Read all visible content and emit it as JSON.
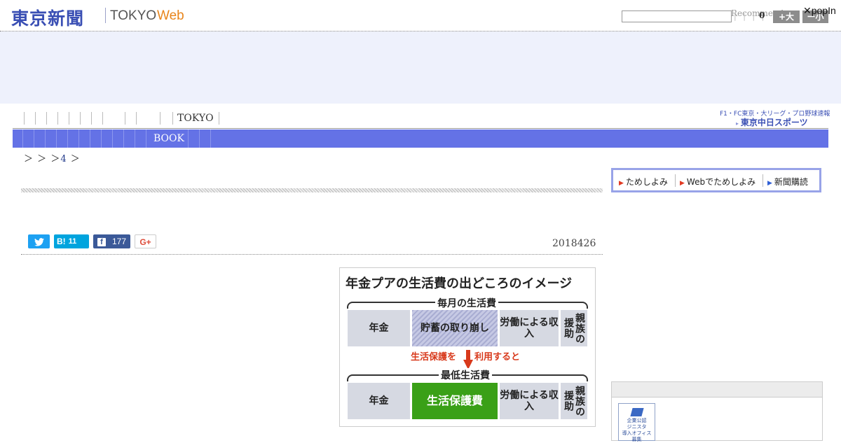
{
  "header": {
    "logo_jp": "東京新聞",
    "logo_tokyo": "TOKYO",
    "logo_web": "Web",
    "search_placeholder": "",
    "recommend_label": "Recommend",
    "share_count": "0",
    "font_large_label": "+大",
    "font_small_label": "ー小",
    "popin_label": "popIn",
    "ticks": "| | | |"
  },
  "nav": {
    "top_label": "TOKYO",
    "blue_label": "BOOK"
  },
  "sports": {
    "top_text": "F1・FC東京・大リーグ・プロ野球速報",
    "logo_text": "東京中日スポーツ"
  },
  "breadcrumb": {
    "part1": "＞",
    "part2": "＞",
    "part3": "＞",
    "link": "4",
    "part4": "＞"
  },
  "subscribe": {
    "item1": "ためしよみ",
    "item2": "Webでためしよみ",
    "item3": "新聞購読"
  },
  "social": {
    "hatena_label": "B!",
    "hatena_count": "11",
    "facebook_count": "177",
    "gplus_label": "G+"
  },
  "article": {
    "date": "2018426"
  },
  "figure": {
    "title": "年金プアの生活費の出どころのイメージ",
    "monthly_label": "毎月の生活費",
    "minimum_label": "最低生活費",
    "arrow_text_left": "生活保護を",
    "arrow_text_right": "利用すると",
    "row1": [
      "年金",
      "貯蓄の取り崩し",
      "労働による収入",
      "親族の援助"
    ],
    "row2": [
      "年金",
      "生活保護費",
      "労働による収入",
      "親族の援助"
    ]
  },
  "sidebar": {
    "banner_line1": "企業公認",
    "banner_line2": "ジニスタ",
    "banner_line3": "導入オフィス",
    "banner_line4": "募集"
  },
  "colors": {
    "brand_blue": "#3a4fb4",
    "nav_blue": "#6472e6",
    "web_orange": "#e8851c",
    "green_cell": "#3aa017",
    "arrow_red": "#d8391b"
  }
}
